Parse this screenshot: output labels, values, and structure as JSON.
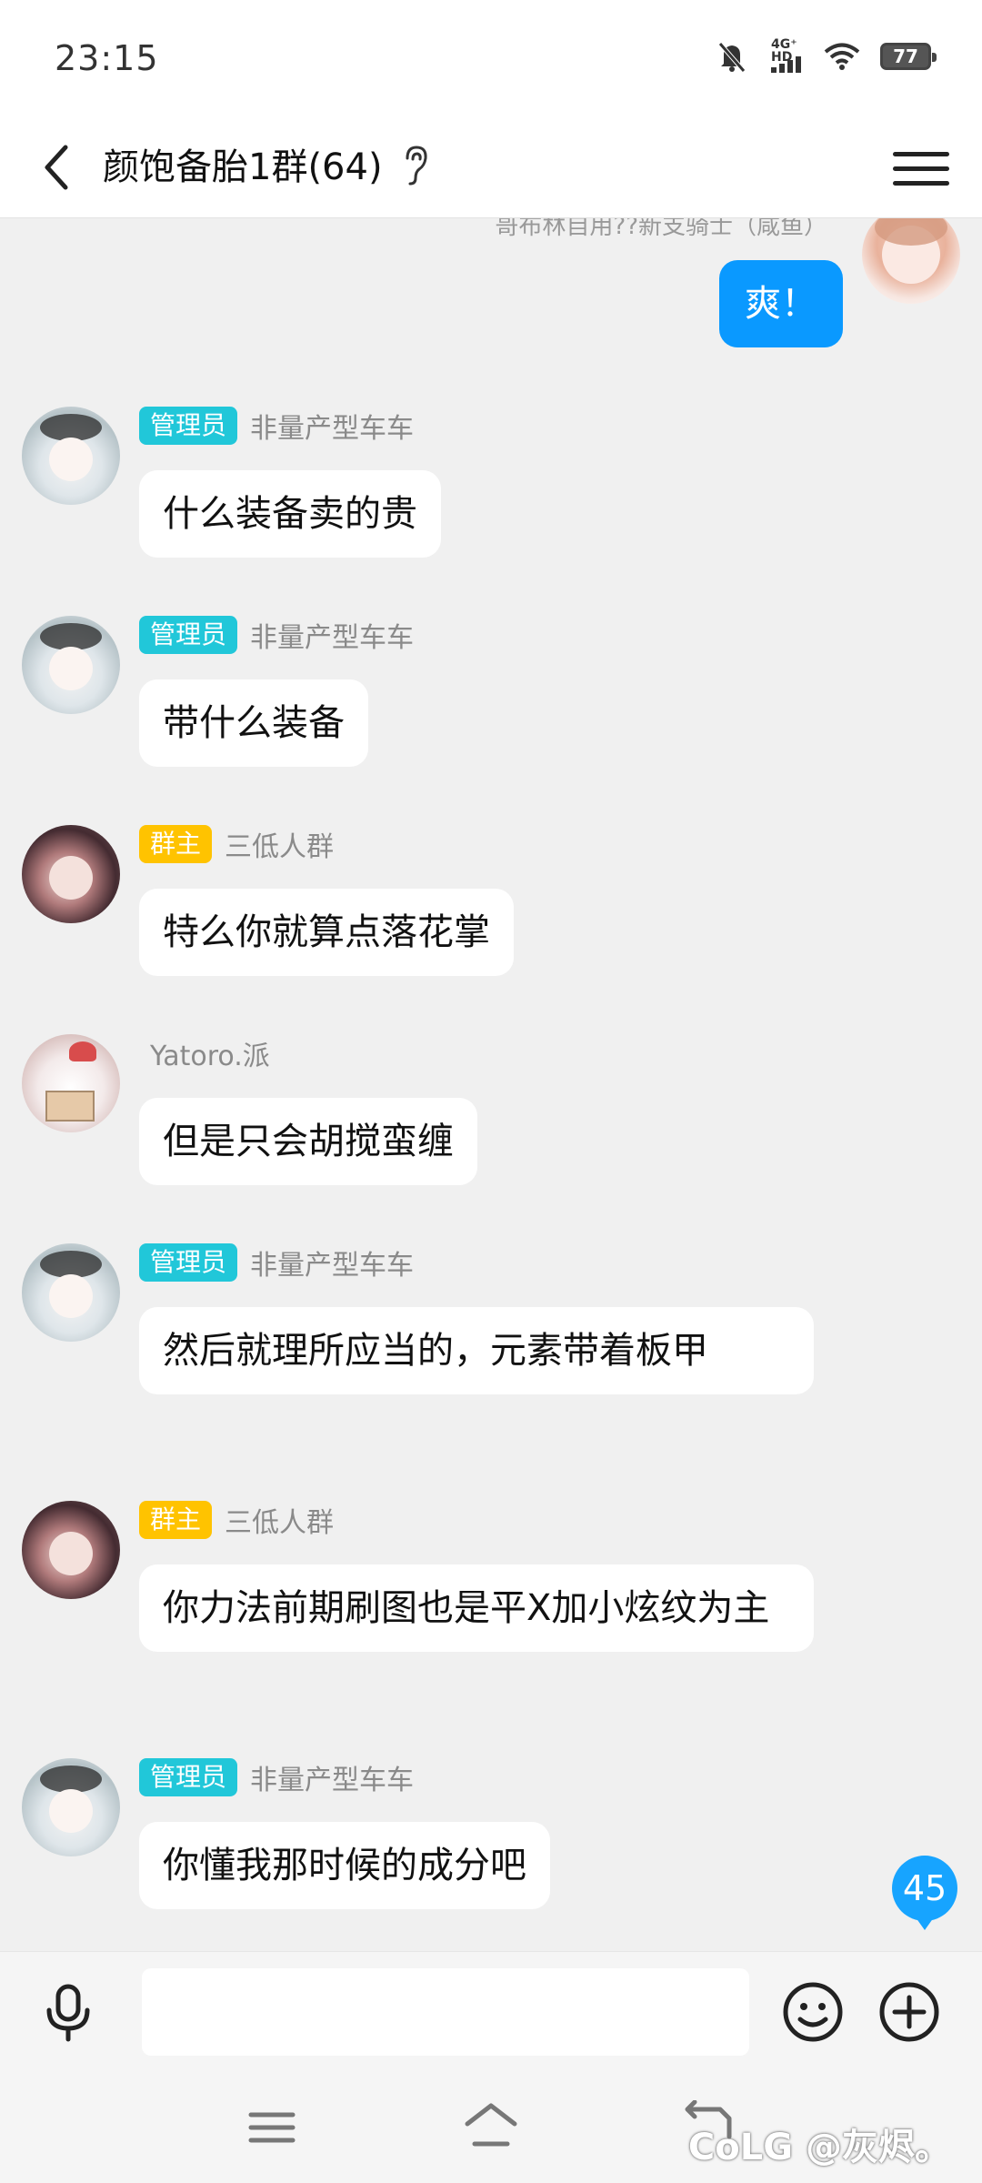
{
  "status_bar": {
    "time": "23:15",
    "network_label": "4G⁺ HD",
    "battery": "77"
  },
  "header": {
    "title": "颜饱备胎1群(64)"
  },
  "chat": {
    "cutoff_text": "哥布林自用??新支骑士（咸鱼）",
    "self_message": "爽！",
    "messages": [
      {
        "badge": "管理员",
        "badge_type": "admin",
        "nick": "非量产型车车",
        "text": "什么装备卖的贵"
      },
      {
        "badge": "管理员",
        "badge_type": "admin",
        "nick": "非量产型车车",
        "text": "带什么装备"
      },
      {
        "badge": "群主",
        "badge_type": "owner",
        "nick": "三低人群",
        "text": "特么你就算点落花掌"
      },
      {
        "badge": "",
        "badge_type": "none",
        "nick": "Yatoro.派",
        "text": "但是只会胡搅蛮缠"
      },
      {
        "badge": "管理员",
        "badge_type": "admin",
        "nick": "非量产型车车",
        "text": "然后就理所应当的，元素带着板甲"
      },
      {
        "badge": "群主",
        "badge_type": "owner",
        "nick": "三低人群",
        "text": "你力法前期刷图也是平X加小炫纹为主"
      },
      {
        "badge": "管理员",
        "badge_type": "admin",
        "nick": "非量产型车车",
        "text": "你懂我那时候的成分吧"
      }
    ],
    "unread_count": "45"
  },
  "watermark": "CoLG @灰烬。",
  "colors": {
    "self_bubble": "#0a99ff",
    "admin_badge": "#21c7d9",
    "owner_badge": "#ffc300",
    "background": "#f0f0f0"
  }
}
